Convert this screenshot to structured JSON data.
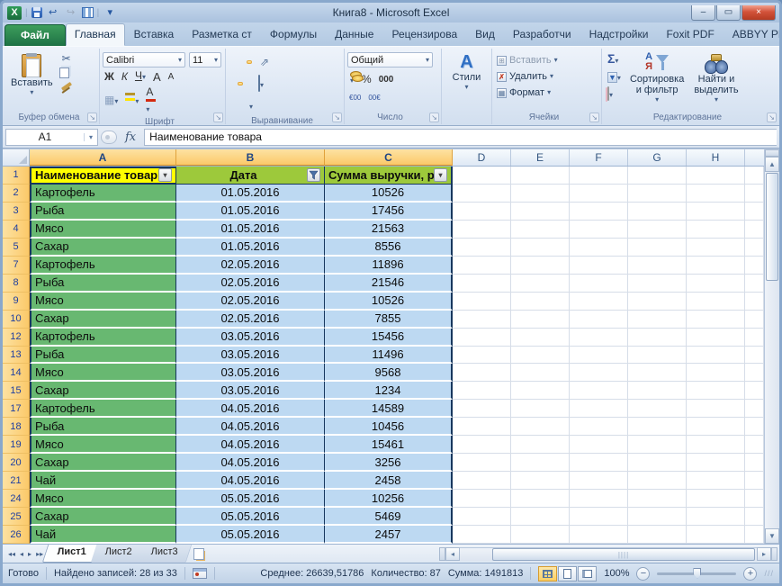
{
  "window": {
    "title": "Книга8  -  Microsoft Excel"
  },
  "icons": {
    "undo": "↩",
    "redo": "↪",
    "qat_more": "▾",
    "excel_x": "X",
    "collapse": "▴",
    "help": "?",
    "min": "–",
    "restore": "▭",
    "close": "×",
    "nav_first": "◂◂",
    "nav_prev": "◂",
    "nav_next": "▸",
    "nav_last": "▸▸",
    "up": "▲",
    "down": "▼",
    "left": "◂",
    "right": "▸",
    "minus": "−",
    "plus": "+",
    "grip": "///",
    "thumb_grip": "||||"
  },
  "ribbon": {
    "file_tab": "Файл",
    "active_tab": "Главная",
    "tabs": [
      "Главная",
      "Вставка",
      "Разметка ст",
      "Формулы",
      "Данные",
      "Рецензирова",
      "Вид",
      "Разработчи",
      "Надстройки",
      "Foxit PDF",
      "ABBYY PDF T"
    ],
    "clipboard": {
      "label": "Буфер обмена",
      "paste": "Вставить",
      "cut": "✂"
    },
    "font": {
      "label": "Шрифт",
      "name": "Calibri",
      "size": "11",
      "bold": "Ж",
      "italic": "К",
      "underline": "Ч",
      "grow": "А",
      "shrink": "А",
      "fontcolor": "А",
      "borders": "▦",
      "orient": "⇗"
    },
    "alignment": {
      "label": "Выравнивание"
    },
    "number": {
      "label": "Число",
      "format": "Общий",
      "percent": "%",
      "thousands": "000",
      "dec_inc": "€00",
      "dec_dec": "00€"
    },
    "styles": {
      "label": "Стили"
    },
    "cells": {
      "label": "Ячейки",
      "insert": "Вставить",
      "del": "Удалить",
      "format": "Формат",
      "ins_g": "⊞",
      "del_g": "✗",
      "fmt_g": "▦"
    },
    "editing": {
      "label": "Редактирование",
      "autosum": "Σ",
      "fill": "▼",
      "sort_a": "А",
      "sort_ya": "Я",
      "sort_line1": "Сортировка",
      "sort_line2": "и фильтр",
      "find_line1": "Найти и",
      "find_line2": "выделить"
    }
  },
  "formula_bar": {
    "name_box": "A1",
    "fx": "fx",
    "formula": "Наименование товара"
  },
  "grid": {
    "columns": [
      "A",
      "B",
      "C",
      "D",
      "E",
      "F",
      "G",
      "H"
    ],
    "header_row": {
      "n": "1",
      "product": "Наименование товар",
      "date": "Дата",
      "sum": "Сумма выручки, ру"
    },
    "rows": [
      {
        "n": "2",
        "name": "Картофель",
        "date": "01.05.2016",
        "amount": "10526"
      },
      {
        "n": "3",
        "name": "Рыба",
        "date": "01.05.2016",
        "amount": "17456"
      },
      {
        "n": "4",
        "name": "Мясо",
        "date": "01.05.2016",
        "amount": "21563"
      },
      {
        "n": "5",
        "name": "Сахар",
        "date": "01.05.2016",
        "amount": "8556"
      },
      {
        "n": "7",
        "name": "Картофель",
        "date": "02.05.2016",
        "amount": "11896"
      },
      {
        "n": "8",
        "name": "Рыба",
        "date": "02.05.2016",
        "amount": "21546"
      },
      {
        "n": "9",
        "name": "Мясо",
        "date": "02.05.2016",
        "amount": "10526"
      },
      {
        "n": "10",
        "name": "Сахар",
        "date": "02.05.2016",
        "amount": "7855"
      },
      {
        "n": "12",
        "name": "Картофель",
        "date": "03.05.2016",
        "amount": "15456"
      },
      {
        "n": "13",
        "name": "Рыба",
        "date": "03.05.2016",
        "amount": "11496"
      },
      {
        "n": "14",
        "name": "Мясо",
        "date": "03.05.2016",
        "amount": "9568"
      },
      {
        "n": "15",
        "name": "Сахар",
        "date": "03.05.2016",
        "amount": "1234"
      },
      {
        "n": "17",
        "name": "Картофель",
        "date": "04.05.2016",
        "amount": "14589"
      },
      {
        "n": "18",
        "name": "Рыба",
        "date": "04.05.2016",
        "amount": "10456"
      },
      {
        "n": "19",
        "name": "Мясо",
        "date": "04.05.2016",
        "amount": "15461"
      },
      {
        "n": "20",
        "name": "Сахар",
        "date": "04.05.2016",
        "amount": "3256"
      },
      {
        "n": "21",
        "name": "Чай",
        "date": "04.05.2016",
        "amount": "2458"
      },
      {
        "n": "24",
        "name": "Мясо",
        "date": "05.05.2016",
        "amount": "10256"
      },
      {
        "n": "25",
        "name": "Сахар",
        "date": "05.05.2016",
        "amount": "5469"
      },
      {
        "n": "26",
        "name": "Чай",
        "date": "05.05.2016",
        "amount": "2457"
      }
    ]
  },
  "sheet_bar": {
    "tabs": [
      "Лист1",
      "Лист2",
      "Лист3"
    ],
    "active": "Лист1"
  },
  "status_bar": {
    "mode": "Готово",
    "found": "Найдено записей: 28 из 33",
    "average": "Среднее: 26639,51786",
    "count": "Количество: 87",
    "sum": "Сумма: 1491813",
    "zoom": "100%"
  },
  "colors": {
    "cell_green": "#68b871",
    "cell_blue": "#bdd9f2",
    "hdr_yellow": "#ffff00",
    "hdr_yellowgreen": "#9dc93b",
    "selection_amber": "#fbc969",
    "file_green": "#1e7145"
  }
}
